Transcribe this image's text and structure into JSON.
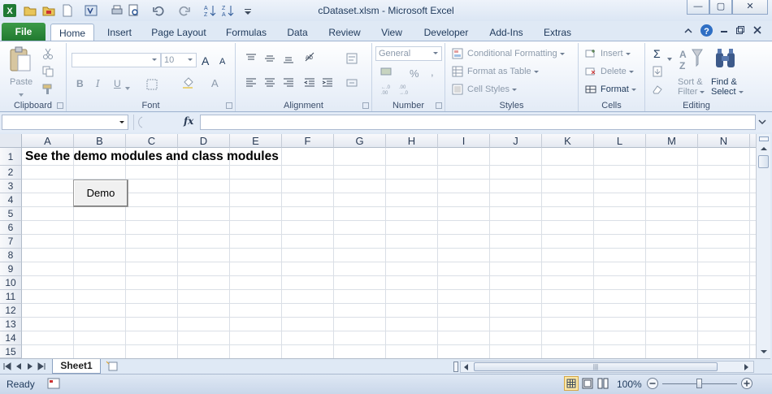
{
  "window": {
    "title": "cDataset.xlsm  -  Microsoft Excel",
    "controls": {
      "minimize": "—",
      "maximize": "▢",
      "close": "✕"
    }
  },
  "tabs": [
    {
      "label": "File"
    },
    {
      "label": "Home"
    },
    {
      "label": "Insert"
    },
    {
      "label": "Page Layout"
    },
    {
      "label": "Formulas"
    },
    {
      "label": "Data"
    },
    {
      "label": "Review"
    },
    {
      "label": "View"
    },
    {
      "label": "Developer"
    },
    {
      "label": "Add-Ins"
    },
    {
      "label": "Extras"
    }
  ],
  "ribbon": {
    "clipboard": {
      "label": "Clipboard",
      "paste": "Paste"
    },
    "font": {
      "label": "Font",
      "font_size": "10",
      "bold": "B",
      "italic": "I",
      "underline": "U",
      "grow": "A",
      "shrink": "A",
      "color": "A"
    },
    "alignment": {
      "label": "Alignment"
    },
    "number": {
      "label": "Number",
      "format": "General",
      "percent": "%",
      "comma": ",",
      "inc_decimal": "+.0\n.00",
      "dec_decimal": ".00\n+.0"
    },
    "styles": {
      "label": "Styles",
      "conditional_formatting": "Conditional Formatting",
      "format_as_table": "Format as Table",
      "cell_styles": "Cell Styles"
    },
    "cells": {
      "label": "Cells",
      "insert": "Insert",
      "delete": "Delete",
      "format": "Format"
    },
    "editing": {
      "label": "Editing",
      "sum": "Σ",
      "sort_filter_1": "Sort &",
      "sort_filter_2": "Filter",
      "find_select_1": "Find &",
      "find_select_2": "Select"
    }
  },
  "formula_bar": {
    "fx": "fx",
    "name_box_value": "",
    "formula_value": ""
  },
  "grid": {
    "columns": [
      "A",
      "B",
      "C",
      "D",
      "E",
      "F",
      "G",
      "H",
      "I",
      "J",
      "K",
      "L",
      "M",
      "N"
    ],
    "rows": [
      "1",
      "2",
      "3",
      "4",
      "5",
      "6",
      "7",
      "8",
      "9",
      "10",
      "11",
      "12",
      "13",
      "14",
      "15"
    ],
    "cell_a1": "See the demo modules and class modules",
    "demo_button": "Demo"
  },
  "sheets": [
    {
      "name": "Sheet1"
    }
  ],
  "status": {
    "mode": "Ready",
    "zoom": "100%"
  }
}
